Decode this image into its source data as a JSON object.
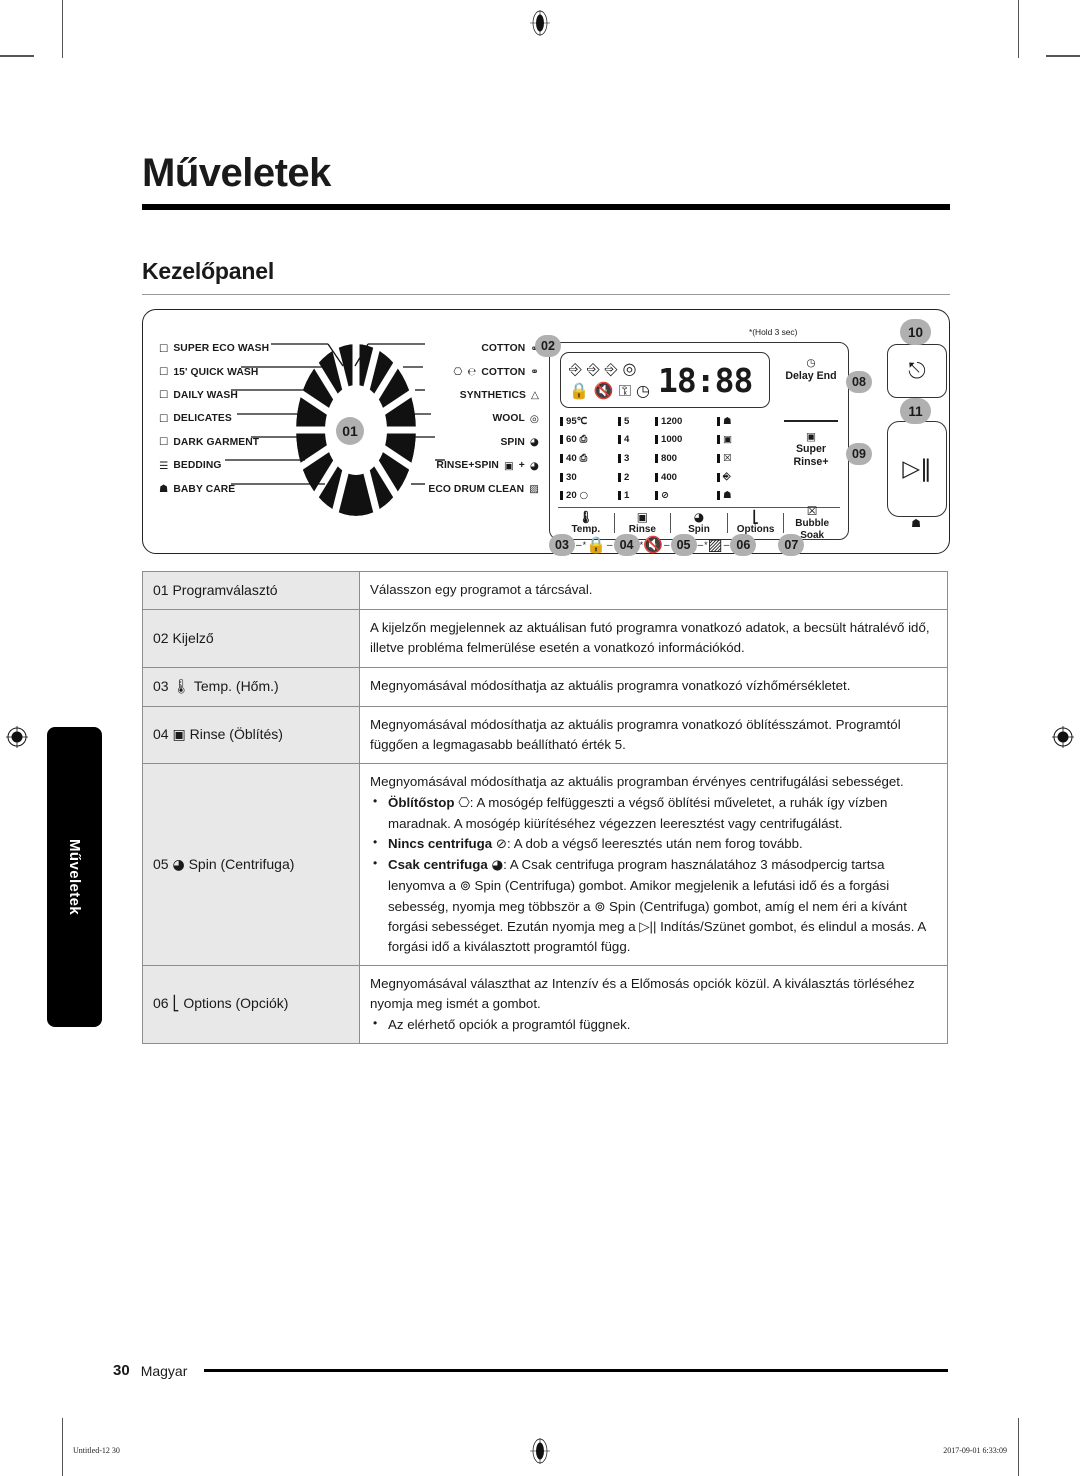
{
  "document": {
    "chapter_title": "Műveletek",
    "side_tab_label": "Műveletek",
    "section_title": "Kezelőpanel"
  },
  "control_panel": {
    "hold_note": "*(Hold 3 sec)",
    "dial_badge": "01",
    "programs_left": [
      {
        "icon": "basket-eco-icon",
        "label": "SUPER ECO WASH"
      },
      {
        "icon": "basket-quick-icon",
        "label": "15' QUICK WASH"
      },
      {
        "icon": "basket-daily-icon",
        "label": "DAILY WASH"
      },
      {
        "icon": "basket-delicates-icon",
        "label": "DELICATES"
      },
      {
        "icon": "basket-dark-icon",
        "label": "DARK GARMENT"
      },
      {
        "icon": "bedding-icon",
        "label": "BEDDING"
      },
      {
        "icon": "baby-care-icon",
        "label": "BABY CARE"
      }
    ],
    "programs_right": [
      {
        "label": "COTTON",
        "icon": "cotton-icon"
      },
      {
        "label": "COTTON",
        "icon": "eco-cotton-icon",
        "prefix": "eco"
      },
      {
        "label": "SYNTHETICS",
        "icon": "synthetics-icon"
      },
      {
        "label": "WOOL",
        "icon": "wool-icon"
      },
      {
        "label": "SPIN",
        "icon": "spin-icon"
      },
      {
        "label": "RINSE+SPIN",
        "icon": "rinse-spin-icon"
      },
      {
        "label": "ECO DRUM CLEAN",
        "icon": "drum-clean-icon"
      }
    ],
    "display": {
      "badge": "02",
      "segment_value": "18:88",
      "status_icons_row1": [
        "wash-icon",
        "wash-intensive-icon",
        "rinse-icon",
        "spin-icon"
      ],
      "status_icons_row2": [
        "child-lock-icon",
        "sound-off-icon",
        "key-lock-icon",
        "delay-clock-icon"
      ]
    },
    "delay_end": {
      "badge": "08",
      "label": "Delay End",
      "icon": "clock-icon"
    },
    "super_rinse": {
      "badge": "09",
      "label": "Super\nRinse+",
      "line1": "Super",
      "line2": "Rinse+",
      "icon": "rinse-plus-icon"
    },
    "led_columns": {
      "temperature": [
        "95℃",
        "60",
        "40",
        "30",
        "20"
      ],
      "temperature_icons": [
        "",
        "60-eco-icon",
        "40-eco-icon",
        "",
        "cold-icon"
      ],
      "rinse_counts": [
        "5",
        "4",
        "3",
        "2",
        "1"
      ],
      "spin_speeds": [
        "1200",
        "1000",
        "800",
        "400",
        "no-spin-icon"
      ],
      "option_icons": [
        "bubble-soak-icon",
        "super-rinse-icon",
        "soak-icon",
        "intensive-icon",
        "prewash-icon"
      ]
    },
    "buttons": [
      {
        "badge": "03",
        "label": "Temp.",
        "icon": "thermometer-icon",
        "alt_icon": "child-lock-icon",
        "alt_star": "*"
      },
      {
        "badge": "04",
        "label": "Rinse",
        "icon": "rinse-basket-icon",
        "alt_icon": "sound-off-icon",
        "alt_star": "*"
      },
      {
        "badge": "05",
        "label": "Spin",
        "icon": "spin-icon",
        "alt_icon": "drum-clean-icon",
        "alt_star": "*"
      },
      {
        "badge": "06",
        "label": "Options",
        "icon": "options-icon"
      },
      {
        "badge": "07",
        "label": "Bubble Soak",
        "icon": "bubble-soak-icon"
      }
    ],
    "power_button": {
      "badge": "10",
      "icon": "power-icon"
    },
    "start_button": {
      "badge": "11",
      "icon": "start-pause-icon",
      "sub_icon": "bubble-soak-icon"
    }
  },
  "table": {
    "rows": [
      {
        "num": "01",
        "key": "Programválasztó",
        "key_icon": "",
        "paragraphs": [
          "Válasszon egy programot a tárcsával."
        ],
        "bullets": []
      },
      {
        "num": "02",
        "key": "Kijelző",
        "key_icon": "",
        "paragraphs": [
          "A kijelzőn megjelennek az aktuálisan futó programra vonatkozó adatok, a becsült hátralévő idő, illetve probléma felmerülése esetén a vonatkozó információkód."
        ],
        "bullets": []
      },
      {
        "num": "03",
        "key": "Temp. (Hőm.)",
        "key_icon": "thermometer-icon",
        "paragraphs": [
          "Megnyomásával módosíthatja az aktuális programra vonatkozó vízhőmérsékletet."
        ],
        "bullets": []
      },
      {
        "num": "04",
        "key": "Rinse (Öblítés)",
        "key_icon": "rinse-basket-icon",
        "paragraphs": [
          "Megnyomásával módosíthatja az aktuális programra vonatkozó öblítésszámot. Programtól függően a legmagasabb beállítható érték 5."
        ],
        "bullets": []
      },
      {
        "num": "05",
        "key": "Spin (Centrifuga)",
        "key_icon": "spin-icon",
        "paragraphs": [
          "Megnyomásával módosíthatja az aktuális programban érvényes centrifugálási sebességet."
        ],
        "bullets": [
          {
            "lead": "Öblítőstop",
            "lead_icon": "rinse-hold-icon",
            "text": ": A mosógép felfüggeszti a végső öblítési műveletet, a ruhák így vízben maradnak. A mosógép kiürítéséhez végezzen leeresztést vagy centrifugálást."
          },
          {
            "lead": "Nincs centrifuga",
            "lead_icon": "no-spin-icon",
            "text": ": A dob a végső leeresztés után nem forog tovább."
          },
          {
            "lead": "Csak centrifuga",
            "lead_icon": "spin-icon",
            "text": ": A Csak centrifuga program használatához 3 másodpercig tartsa lenyomva a ⊚ Spin (Centrifuga) gombot. Amikor megjelenik a lefutási idő és a forgási sebesség, nyomja meg többször a ⊚ Spin (Centrifuga) gombot, amíg el nem éri a kívánt forgási sebességet. Ezután nyomja meg a ▷|| Indítás/Szünet gombot, és elindul a mosás. A forgási idő a kiválasztott programtól függ."
          }
        ]
      },
      {
        "num": "06",
        "key": "Options (Opciók)",
        "key_icon": "options-icon",
        "paragraphs": [
          "Megnyomásával választhat az Intenzív és a Előmosás opciók közül. A kiválasztás törléséhez nyomja meg ismét a gombot."
        ],
        "bullets": [
          {
            "lead": "",
            "lead_icon": "",
            "text": "Az elérhető opciók a programtól függnek."
          }
        ]
      }
    ]
  },
  "footer": {
    "page_number": "30",
    "language": "Magyar",
    "slug_left": "Untitled-12   30",
    "slug_right": "2017-09-01   6:33:09"
  }
}
